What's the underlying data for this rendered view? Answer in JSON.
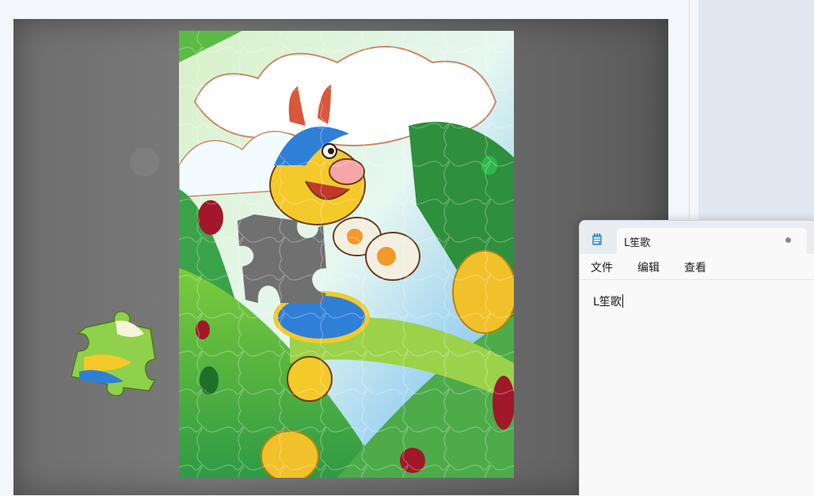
{
  "notepad": {
    "tab_title": "L笙歌",
    "menu": [
      "文件",
      "编辑",
      "查看"
    ],
    "content": "L笙歌"
  },
  "icons": {
    "app": "notepad-icon",
    "tab_status": "unsaved-dot-icon"
  },
  "colors": {
    "board": "#707070",
    "sky": "#8fd0f4",
    "leaf_dark": "#1f8a3a",
    "leaf_light": "#9bd24a",
    "dragon_yellow": "#f4c92a",
    "dragon_blue": "#2f7fd6",
    "egg_yellow": "#f1c12b",
    "notepad_bg": "#f9f9f9"
  }
}
